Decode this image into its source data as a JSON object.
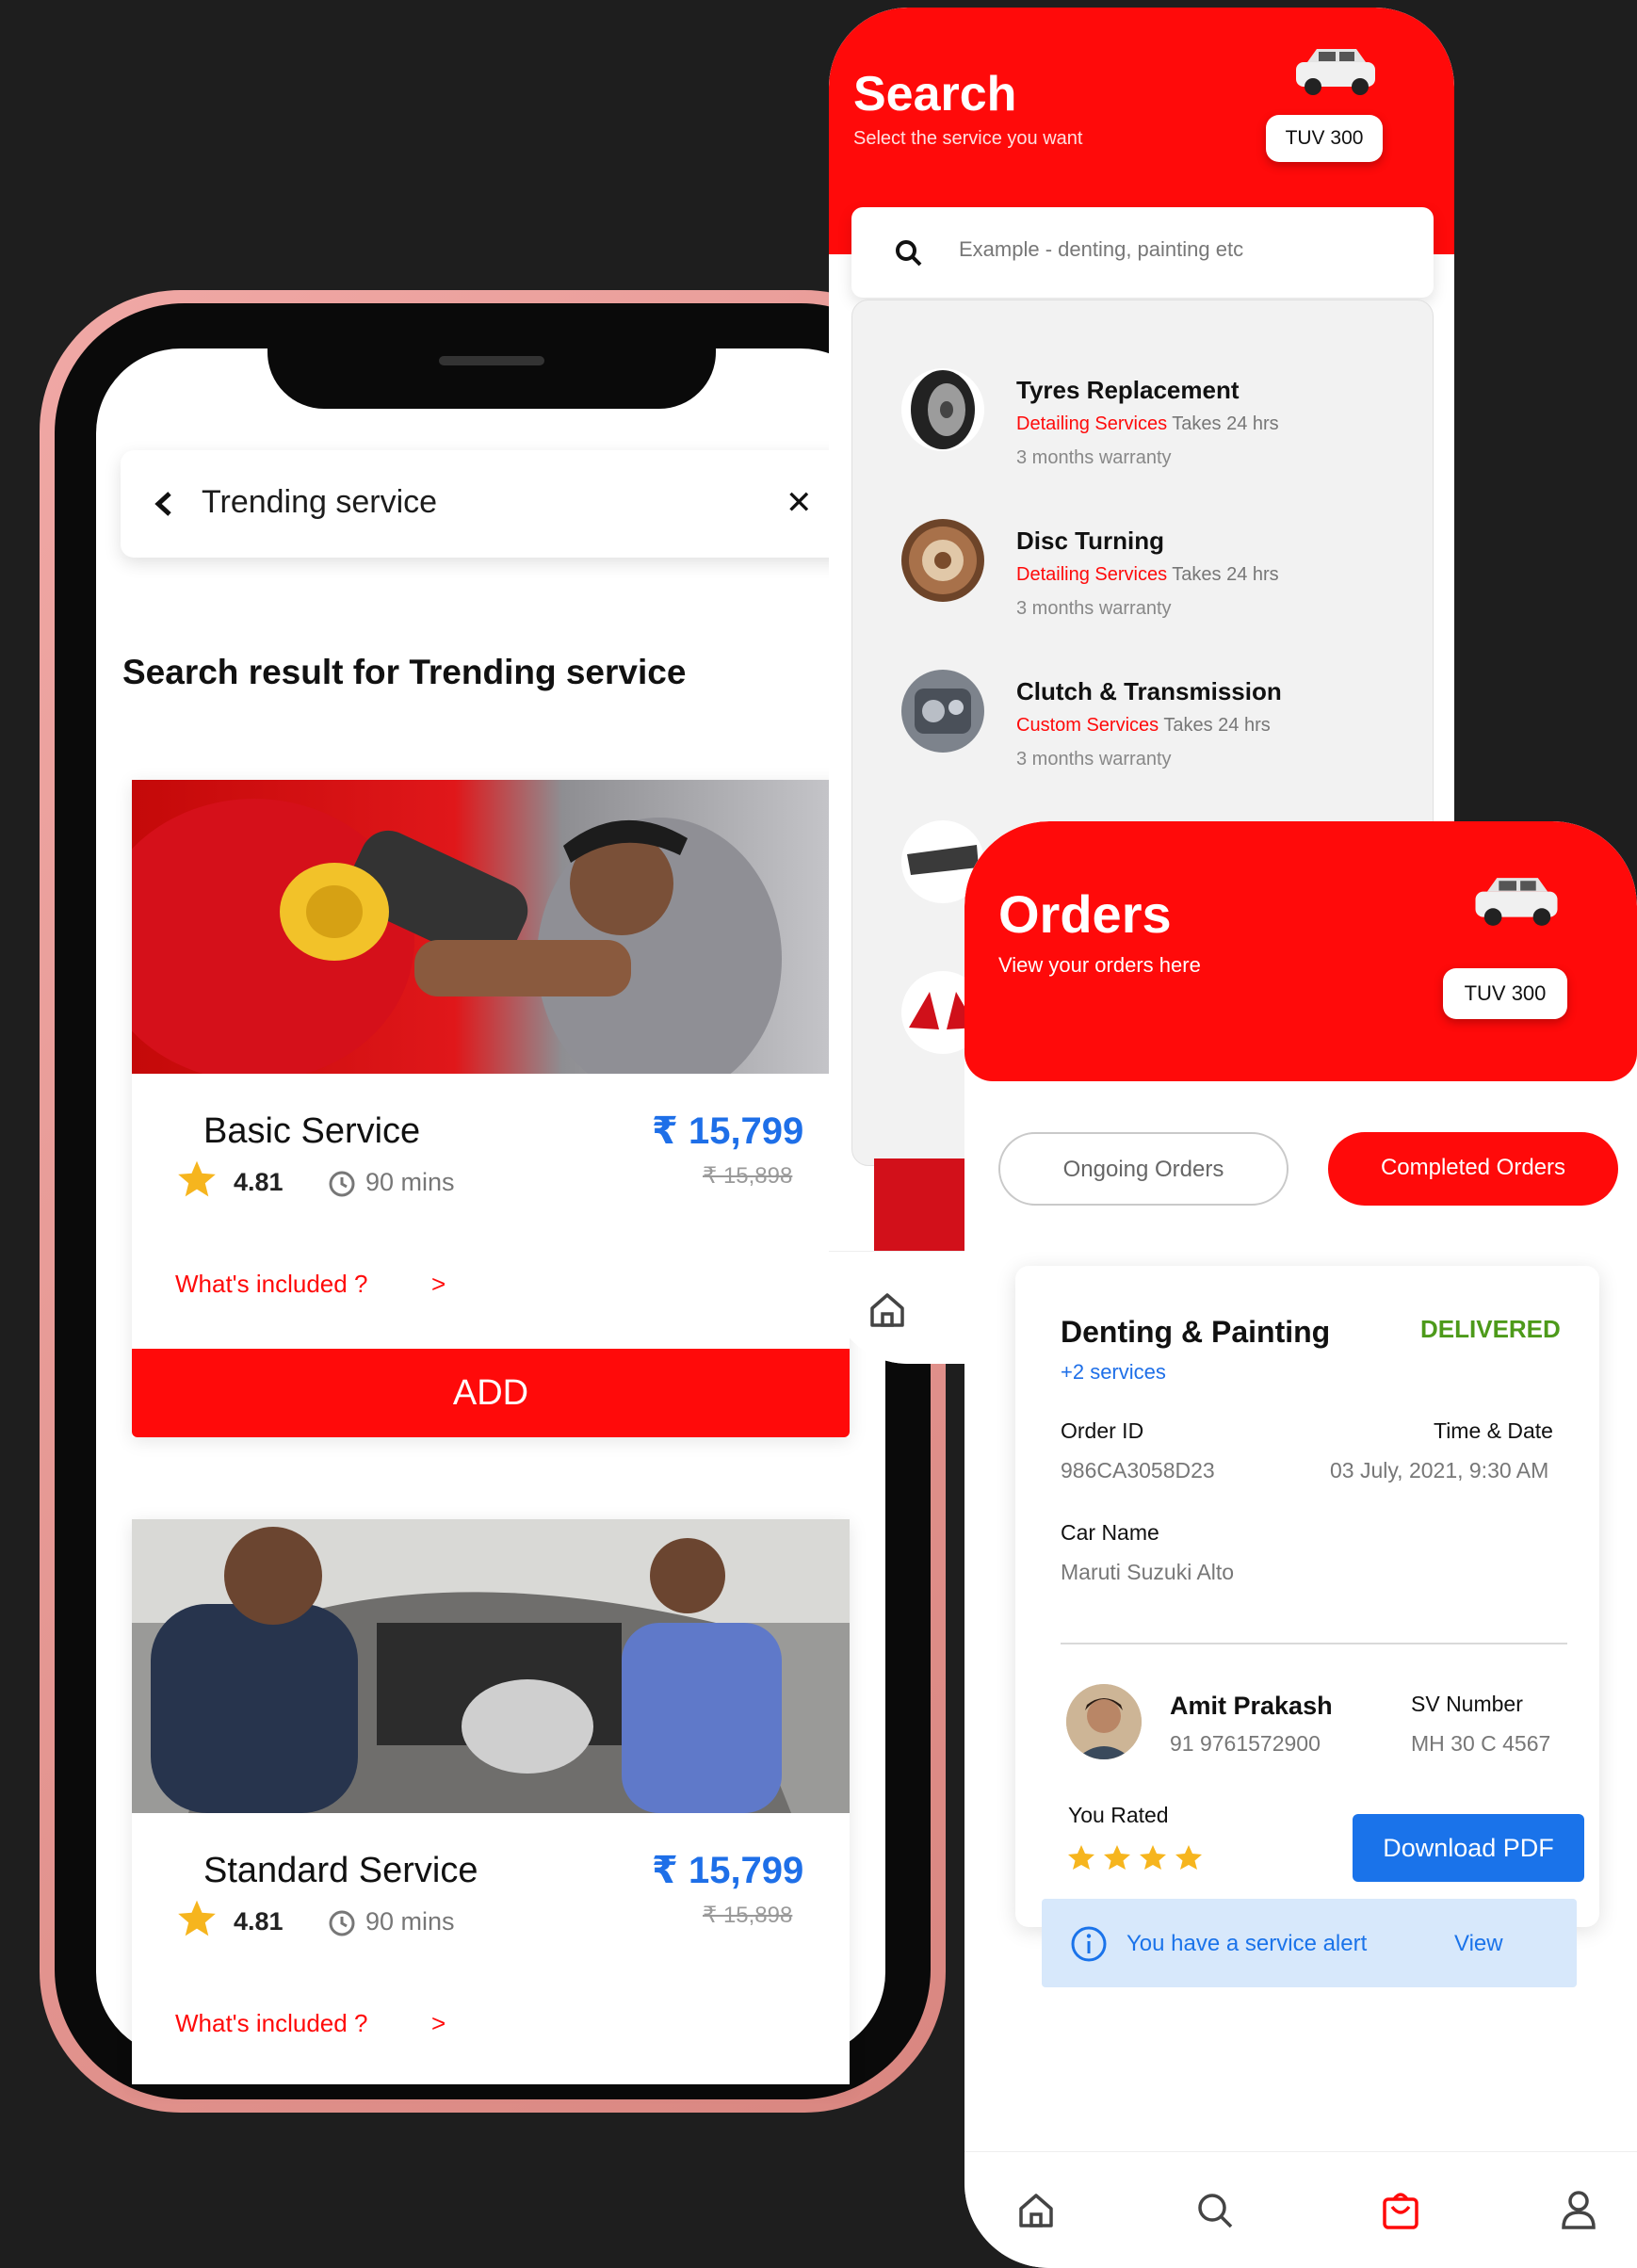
{
  "colors": {
    "brand_red": "#ff0a0a",
    "price_blue": "#1e6fe8",
    "delivered_green": "#4d9a1a",
    "alert_bg": "#d7e8fb"
  },
  "trending": {
    "header_title": "Trending service",
    "back_icon": "chevron-left-icon",
    "close_icon": "close-icon",
    "result_heading": "Search result for Trending service",
    "services": [
      {
        "name": "Basic Service",
        "price": "₹ 15,799",
        "old_price": "₹ 15,898",
        "rating": "4.81",
        "duration": "90 mins",
        "included": "What's included ?",
        "add_label": "ADD"
      },
      {
        "name": "Standard Service",
        "price": "₹ 15,799",
        "old_price": "₹ 15,898",
        "rating": "4.81",
        "duration": "90 mins",
        "included": "What's included ?"
      }
    ]
  },
  "search": {
    "title": "Search",
    "subtitle": "Select the service you want",
    "car_badge": "TUV 300",
    "placeholder": "Example - denting, painting etc",
    "items": [
      {
        "title": "Tyres Replacement",
        "category": "Detailing Services",
        "duration": "Takes 24 hrs",
        "warranty": "3 months warranty",
        "icon": "tyre-icon"
      },
      {
        "title": "Disc Turning",
        "category": "Detailing Services",
        "duration": "Takes 24 hrs",
        "warranty": "3 months warranty",
        "icon": "disc-icon"
      },
      {
        "title": "Clutch & Transmission",
        "category": "Custom Services",
        "duration": "Takes 24 hrs",
        "warranty": "3 months warranty",
        "icon": "clutch-icon"
      }
    ]
  },
  "orders": {
    "title": "Orders",
    "subtitle": "View your orders here",
    "car_badge": "TUV 300",
    "tabs": {
      "ongoing": "Ongoing Orders",
      "completed": "Completed Orders"
    },
    "order": {
      "service": "Denting & Painting",
      "extra": "+2 services",
      "status": "DELIVERED",
      "order_id_label": "Order ID",
      "order_id": "986CA3058D23",
      "time_label": "Time & Date",
      "time": "03 July, 2021, 9:30 AM",
      "car_label": "Car Name",
      "car": "Maruti Suzuki Alto",
      "person_name": "Amit Prakash",
      "person_phone": "91 9761572900",
      "sv_label": "SV Number",
      "sv": "MH 30 C 4567",
      "rated_label": "You Rated",
      "rating_stars": 4,
      "download_label": "Download PDF",
      "alert_text": "You have a service alert",
      "alert_action": "View"
    },
    "nav": [
      "home-icon",
      "search-icon",
      "bag-icon",
      "profile-icon"
    ]
  }
}
